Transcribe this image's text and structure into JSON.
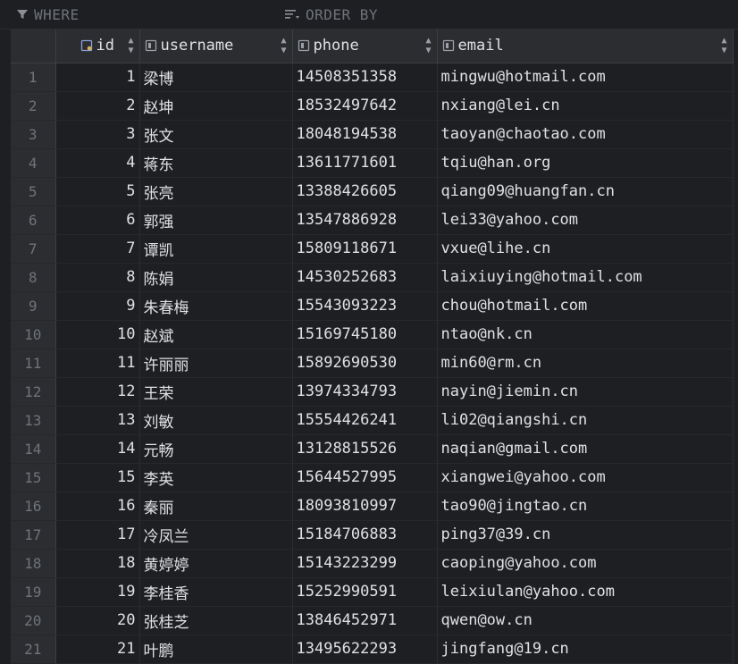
{
  "filterbar": {
    "where_label": "WHERE",
    "orderby_label": "ORDER BY"
  },
  "columns": {
    "id": "id",
    "username": "username",
    "phone": "phone",
    "email": "email"
  },
  "rows": [
    {
      "rn": "1",
      "id": "1",
      "username": "梁博",
      "phone": "14508351358",
      "email": "mingwu@hotmail.com"
    },
    {
      "rn": "2",
      "id": "2",
      "username": "赵坤",
      "phone": "18532497642",
      "email": "nxiang@lei.cn"
    },
    {
      "rn": "3",
      "id": "3",
      "username": "张文",
      "phone": "18048194538",
      "email": "taoyan@chaotao.com"
    },
    {
      "rn": "4",
      "id": "4",
      "username": "蒋东",
      "phone": "13611771601",
      "email": "tqiu@han.org"
    },
    {
      "rn": "5",
      "id": "5",
      "username": "张亮",
      "phone": "13388426605",
      "email": "qiang09@huangfan.cn"
    },
    {
      "rn": "6",
      "id": "6",
      "username": "郭强",
      "phone": "13547886928",
      "email": "lei33@yahoo.com"
    },
    {
      "rn": "7",
      "id": "7",
      "username": "谭凯",
      "phone": "15809118671",
      "email": "vxue@lihe.cn"
    },
    {
      "rn": "8",
      "id": "8",
      "username": "陈娟",
      "phone": "14530252683",
      "email": "laixiuying@hotmail.com"
    },
    {
      "rn": "9",
      "id": "9",
      "username": "朱春梅",
      "phone": "15543093223",
      "email": "chou@hotmail.com"
    },
    {
      "rn": "10",
      "id": "10",
      "username": "赵斌",
      "phone": "15169745180",
      "email": "ntao@nk.cn"
    },
    {
      "rn": "11",
      "id": "11",
      "username": "许丽丽",
      "phone": "15892690530",
      "email": "min60@rm.cn"
    },
    {
      "rn": "12",
      "id": "12",
      "username": "王荣",
      "phone": "13974334793",
      "email": "nayin@jiemin.cn"
    },
    {
      "rn": "13",
      "id": "13",
      "username": "刘敏",
      "phone": "15554426241",
      "email": "li02@qiangshi.cn"
    },
    {
      "rn": "14",
      "id": "14",
      "username": "元畅",
      "phone": "13128815526",
      "email": "naqian@gmail.com"
    },
    {
      "rn": "15",
      "id": "15",
      "username": "李英",
      "phone": "15644527995",
      "email": "xiangwei@yahoo.com"
    },
    {
      "rn": "16",
      "id": "16",
      "username": "秦丽",
      "phone": "18093810997",
      "email": "tao90@jingtao.cn"
    },
    {
      "rn": "17",
      "id": "17",
      "username": "冷凤兰",
      "phone": "15184706883",
      "email": "ping37@39.cn"
    },
    {
      "rn": "18",
      "id": "18",
      "username": "黄婷婷",
      "phone": "15143223299",
      "email": "caoping@yahoo.com"
    },
    {
      "rn": "19",
      "id": "19",
      "username": "李桂香",
      "phone": "15252990591",
      "email": "leixiulan@yahoo.com"
    },
    {
      "rn": "20",
      "id": "20",
      "username": "张桂芝",
      "phone": "13846452971",
      "email": "qwen@ow.cn"
    },
    {
      "rn": "21",
      "id": "21",
      "username": "叶鹏",
      "phone": "13495622293",
      "email": "jingfang@19.cn"
    }
  ]
}
